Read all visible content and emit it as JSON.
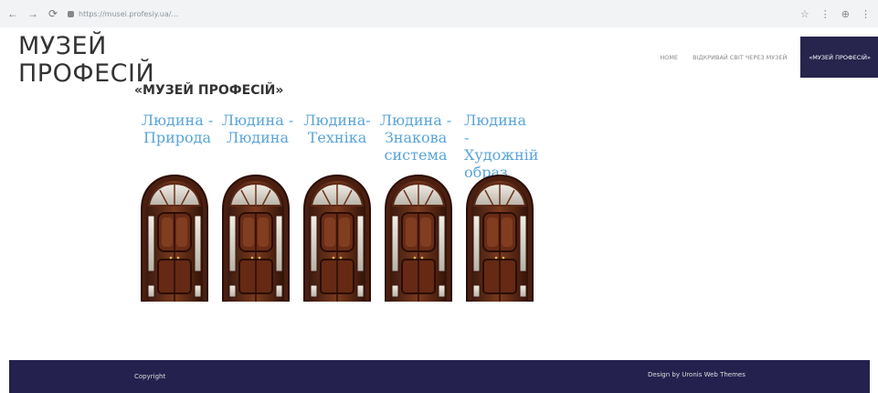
{
  "browser": {
    "url": "https://musei.profesiy.ua/...",
    "back": "←",
    "forward": "→",
    "reload": "⟳",
    "actions": [
      "☆",
      "⋮",
      "⊕",
      "⋮"
    ]
  },
  "site": {
    "title_line1": "МУЗЕЙ",
    "title_line2": "ПРОФЕСІЙ"
  },
  "menu": {
    "home": "HOME",
    "world": "ВІДКРИВАЙ СВІТ ЧЕРЕЗ МУЗЕЙ",
    "museum": "«МУЗЕЙ ПРОФЕСІЙ»"
  },
  "page": {
    "heading": "«МУЗЕЙ ПРОФЕСІЙ»",
    "categories": [
      {
        "line1": "Людина -",
        "line2": "Природа",
        "line3": ""
      },
      {
        "line1": "Людина -",
        "line2": "Людина",
        "line3": ""
      },
      {
        "line1": "Людина-",
        "line2": "Техніка",
        "line3": ""
      },
      {
        "line1": "Людина -",
        "line2": "Знакова",
        "line3": "система"
      },
      {
        "line1": "Людина -",
        "line2": "Художній",
        "line3": "образ"
      }
    ]
  },
  "footer": {
    "copyright": "Copyright",
    "design": "Design by Uronis Web Themes"
  },
  "colors": {
    "nav_active": "#27244d",
    "footer": "#25214f",
    "category_text": "#5aa4d8"
  }
}
